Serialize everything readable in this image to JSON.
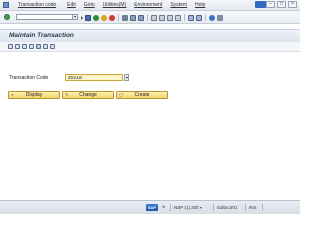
{
  "menubar": {
    "items": [
      "Transaction code",
      "Edit",
      "Goto",
      "Utilities(M)",
      "Environment",
      "System",
      "Help"
    ]
  },
  "title": {
    "text": "Maintain Transaction"
  },
  "form": {
    "field_label": "Transaction Code",
    "tcode_value": "ZSALE"
  },
  "buttons": {
    "display": "Display",
    "change": "Change",
    "create": "Create"
  },
  "statusbar": {
    "brand": "SAP",
    "system": "NSP (1) 200",
    "server": "EditorJr01",
    "mode": "INS"
  },
  "colors": {
    "title_text": "#2a3950",
    "button_fill": "#f2d56b",
    "input_highlight": "#fff4c7"
  }
}
